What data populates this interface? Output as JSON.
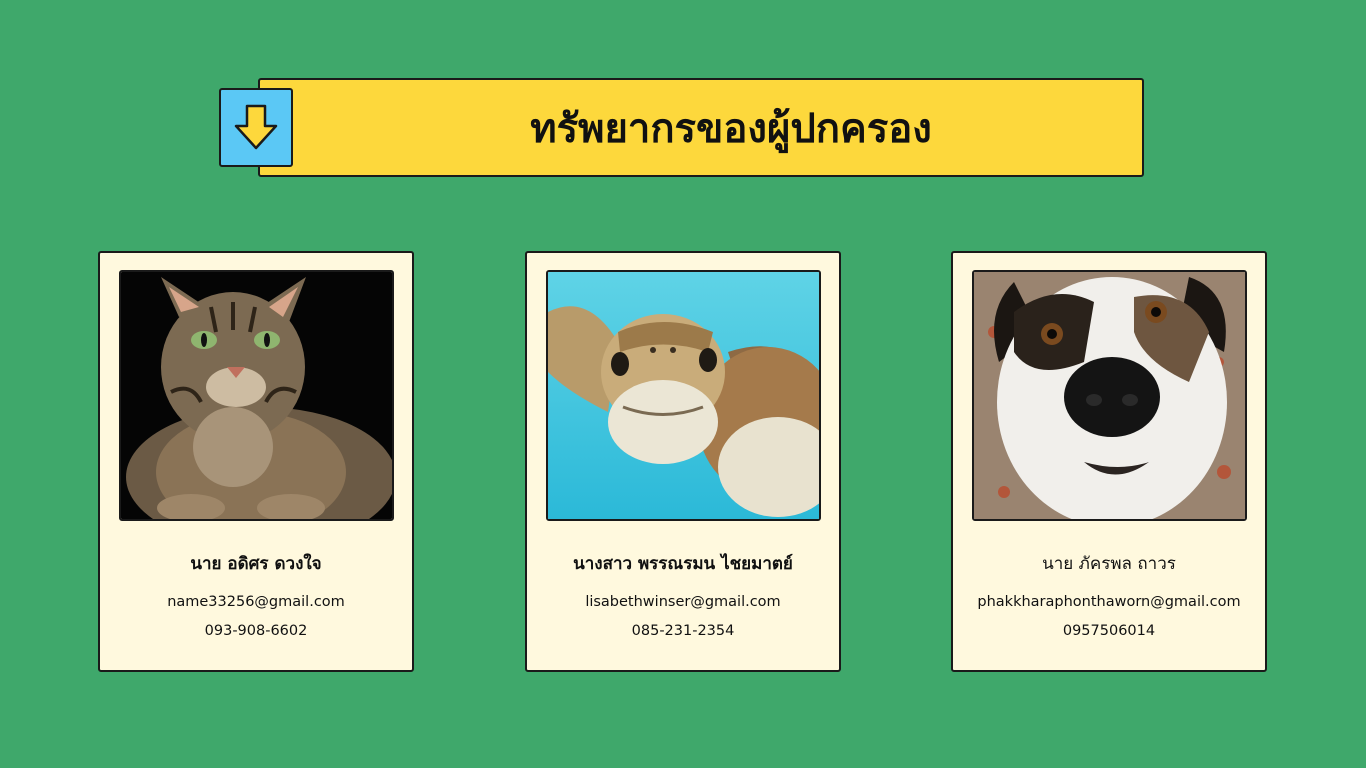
{
  "header": {
    "title": "ทรัพยากรของผู้ปกครอง",
    "icon": "down-arrow-icon",
    "colors": {
      "banner": "#fdd83c",
      "icon_box": "#5bc8f5",
      "arrow": "#fdd83c",
      "background": "#3fa86b",
      "card": "#fff9de"
    }
  },
  "cards": [
    {
      "name": "นาย อดิศร ดวงใจ",
      "email": "name33256@gmail.com",
      "phone": "093-908-6602",
      "photo": "cat-photo"
    },
    {
      "name": "นางสาว พรรณรมน ไชยมาตย์",
      "email": "lisabethwinser@gmail.com",
      "phone": "085-231-2354",
      "photo": "sea-turtle-photo"
    },
    {
      "name": "นาย ภัครพล ถาวร",
      "email": "phakkharaphonthaworn@gmail.com",
      "phone": "0957506014",
      "photo": "dog-photo"
    }
  ]
}
